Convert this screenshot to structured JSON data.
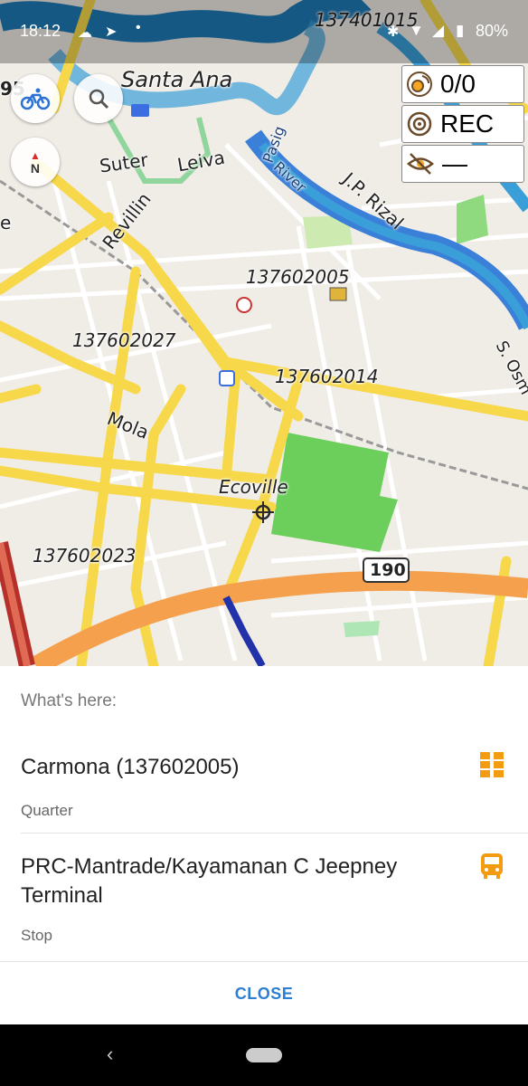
{
  "status_bar": {
    "time": "18:12",
    "battery": "80%"
  },
  "map": {
    "labels": {
      "top_number": "137401015",
      "edge_number": "95",
      "santa_ana": "Santa Ana",
      "suter": "Suter",
      "leiva": "Leiva",
      "revillin": "Revillin",
      "pasig": "Pasig",
      "river": "River",
      "jp_rizal": "J.P. Rizal",
      "num_005": "137602005",
      "num_027": "137602027",
      "num_014": "137602014",
      "s_osm": "S. Osm",
      "mola": "Mola",
      "ecoville": "Ecoville",
      "num_023": "137602023",
      "road_shield": "190",
      "left_edge": "e"
    },
    "compass_letter": "N",
    "widgets": {
      "gps_count": "0/0",
      "rec_label": "REC",
      "visibility_value": "—"
    }
  },
  "sheet": {
    "title": "What's here:",
    "items": [
      {
        "name": "Carmona (137602005)",
        "type": "Quarter",
        "icon": "grid-icon"
      },
      {
        "name": "PRC-Mantrade/Kayamanan C Jeepney Terminal",
        "type": "Stop",
        "icon": "bus-icon"
      }
    ],
    "close_label": "CLOSE"
  },
  "colors": {
    "accent": "#2d7fd3",
    "poi_orange": "#f39c12",
    "park": "#6ccf5c",
    "river": "#3a9fd8",
    "major_road": "#f7c940"
  }
}
